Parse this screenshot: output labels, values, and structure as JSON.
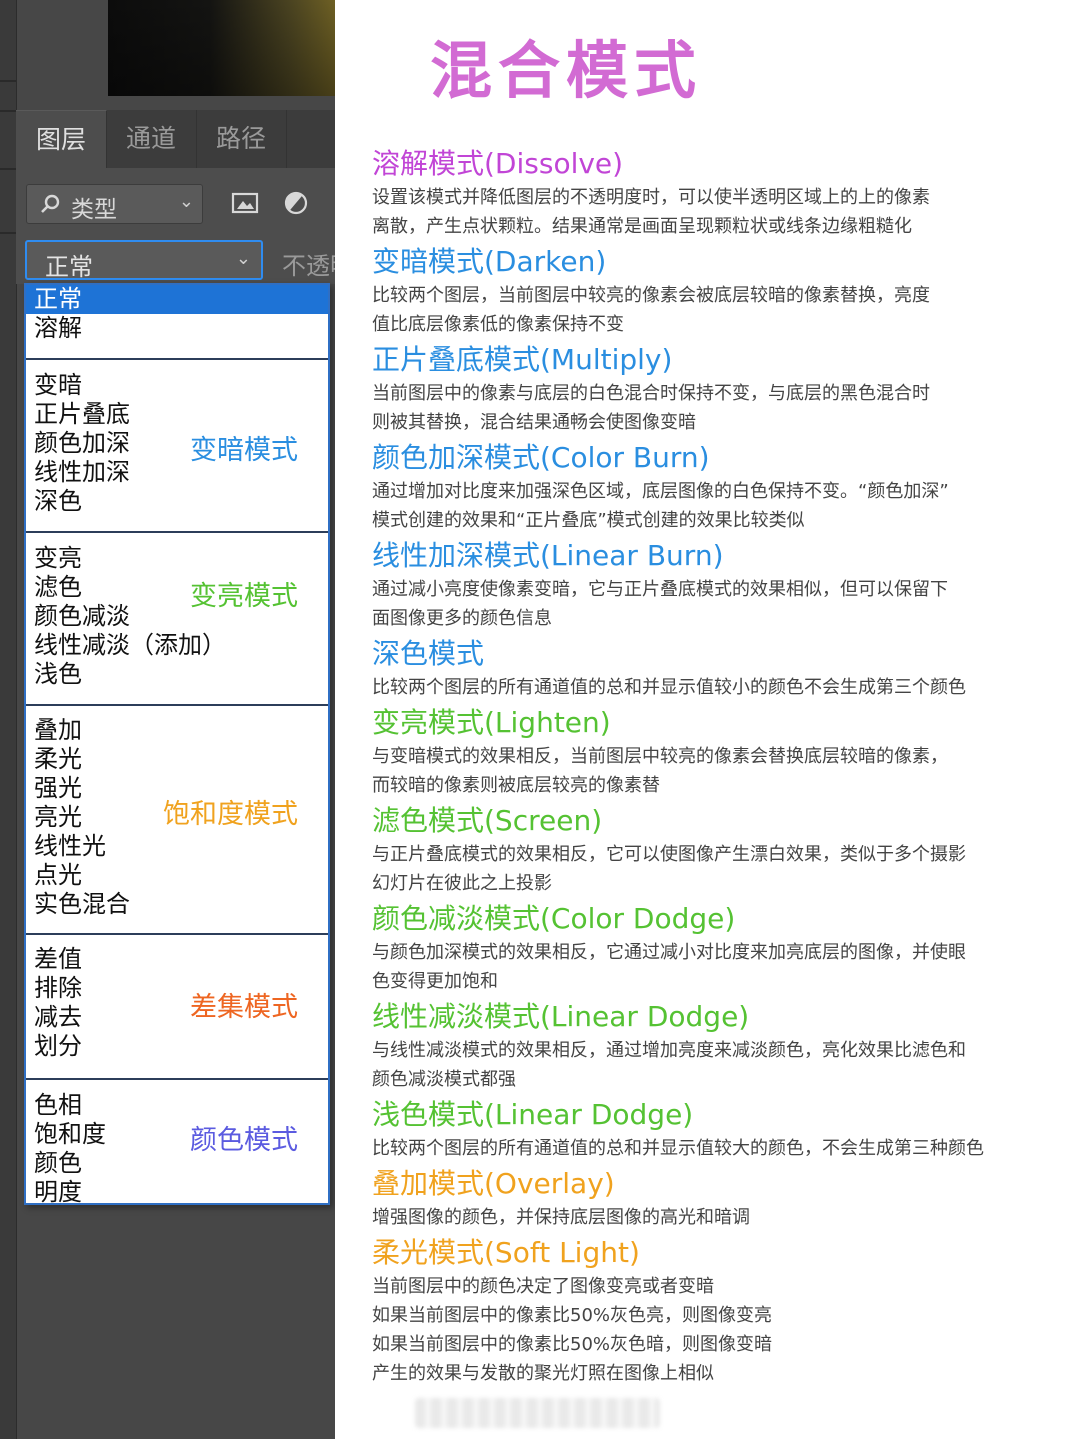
{
  "panel": {
    "tabs": [
      {
        "label": "图层",
        "active": true
      },
      {
        "label": "通道",
        "active": false
      },
      {
        "label": "路径",
        "active": false
      }
    ],
    "filter": {
      "kind_label": "类型"
    },
    "blend": {
      "selected": "正常",
      "opacity_label": "不透明"
    },
    "menu": {
      "groups": [
        {
          "items": [
            "正常",
            "溶解"
          ],
          "label": "",
          "label_color": ""
        },
        {
          "items": [
            "变暗",
            "正片叠底",
            "颜色加深",
            "线性加深",
            "深色"
          ],
          "label": "变暗模式",
          "label_color": "#2a8ee0"
        },
        {
          "items": [
            "变亮",
            "滤色",
            "颜色减淡",
            "线性减淡（添加）",
            "浅色"
          ],
          "label": "变亮模式",
          "label_color": "#55c233"
        },
        {
          "items": [
            "叠加",
            "柔光",
            "强光",
            "亮光",
            "线性光",
            "点光",
            "实色混合"
          ],
          "label": "饱和度模式",
          "label_color": "#f0a21e"
        },
        {
          "items": [
            "差值",
            "排除",
            "减去",
            "划分"
          ],
          "label": "差集模式",
          "label_color": "#ee6622"
        },
        {
          "items": [
            "色相",
            "饱和度",
            "颜色",
            "明度"
          ],
          "label": "颜色模式",
          "label_color": "#5b5be0"
        }
      ]
    }
  },
  "article": {
    "title": "混合模式",
    "title_color": "#d26bd3",
    "entries": [
      {
        "title": "溶解模式(Dissolve)",
        "color": "#c145d6",
        "lines": [
          "设置该模式并降低图层的不透明度时，可以使半透明区域上的上的像素",
          "离散，产生点状颗粒。结果通常是画面呈现颗粒状或线条边缘粗糙化"
        ]
      },
      {
        "title": "变暗模式(Darken)",
        "color": "#2a8ee0",
        "lines": [
          "比较两个图层，当前图层中较亮的像素会被底层较暗的像素替换，亮度",
          "值比底层像素低的像素保持不变"
        ]
      },
      {
        "title": "正片叠底模式(Multiply)",
        "color": "#2a8ee0",
        "lines": [
          "当前图层中的像素与底层的白色混合时保持不变，与底层的黑色混合时",
          "则被其替换，混合结果通畅会使图像变暗"
        ]
      },
      {
        "title": "颜色加深模式(Color Burn)",
        "color": "#2a8ee0",
        "lines": [
          "通过增加对比度来加强深色区域，底层图像的白色保持不变。“颜色加深”",
          "模式创建的效果和“正片叠底”模式创建的效果比较类似"
        ]
      },
      {
        "title": "线性加深模式(Linear Burn)",
        "color": "#2a8ee0",
        "lines": [
          "通过减小亮度使像素变暗，它与正片叠底模式的效果相似，但可以保留下",
          "面图像更多的颜色信息"
        ]
      },
      {
        "title": "深色模式",
        "color": "#2a8ee0",
        "lines": [
          "比较两个图层的所有通道值的总和并显示值较小的颜色不会生成第三个颜色"
        ]
      },
      {
        "title": "变亮模式(Lighten)",
        "color": "#55c233",
        "lines": [
          "与变暗模式的效果相反，当前图层中较亮的像素会替换底层较暗的像素，",
          "而较暗的像素则被底层较亮的像素替"
        ]
      },
      {
        "title": "滤色模式(Screen)",
        "color": "#55c233",
        "lines": [
          "与正片叠底模式的效果相反，它可以使图像产生漂白效果，类似于多个摄影",
          "幻灯片在彼此之上投影"
        ]
      },
      {
        "title": "颜色减淡模式(Color Dodge)",
        "color": "#55c233",
        "lines": [
          "与颜色加深模式的效果相反，它通过减小对比度来加亮底层的图像，并使眼",
          "色变得更加饱和"
        ]
      },
      {
        "title": "线性减淡模式(Linear Dodge)",
        "color": "#55c233",
        "lines": [
          "与线性减淡模式的效果相反，通过增加亮度来减淡颜色，亮化效果比滤色和",
          "颜色减淡模式都强"
        ]
      },
      {
        "title": "浅色模式(Linear Dodge)",
        "color": "#55c233",
        "lines": [
          "比较两个图层的所有通道值的总和并显示值较大的颜色，不会生成第三种颜色"
        ]
      },
      {
        "title": "叠加模式(Overlay)",
        "color": "#f0a21e",
        "lines": [
          "增强图像的颜色，并保持底层图像的高光和暗调"
        ]
      },
      {
        "title": "柔光模式(Soft Light)",
        "color": "#f0a21e",
        "lines": [
          "当前图层中的颜色决定了图像变亮或者变暗",
          "如果当前图层中的像素比50%灰色亮，则图像变亮",
          "如果当前图层中的像素比50%灰色暗，则图像变暗",
          "产生的效果与发散的聚光灯照在图像上相似"
        ]
      }
    ]
  }
}
